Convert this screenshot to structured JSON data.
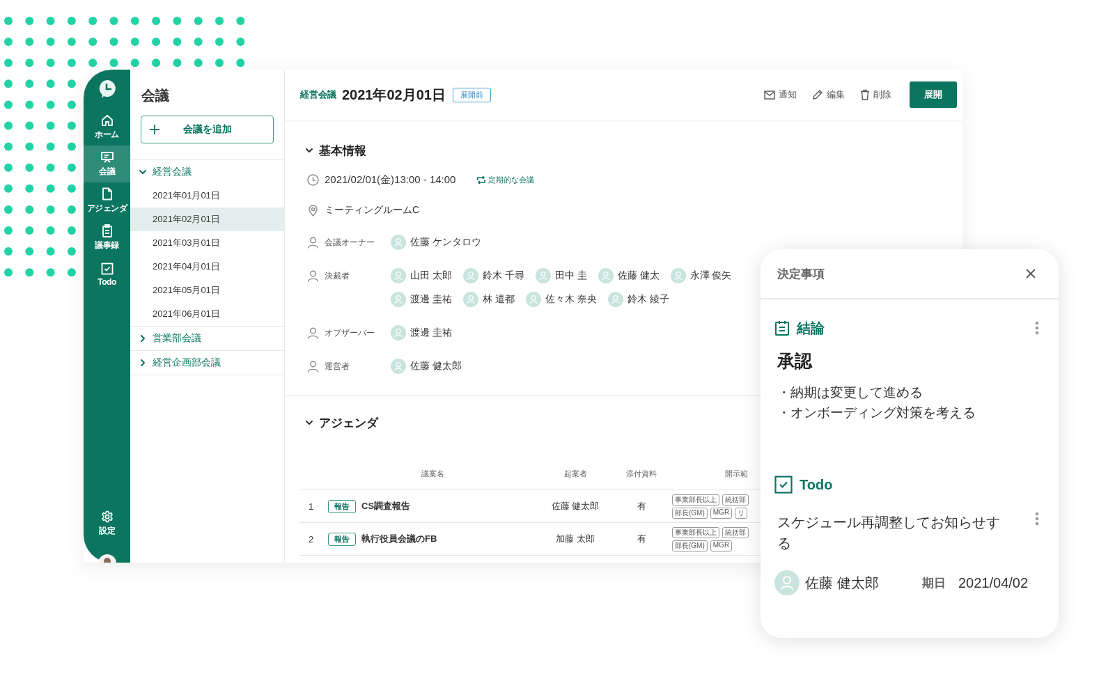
{
  "nav_rail": {
    "items": [
      {
        "label": "ホーム",
        "selected": false
      },
      {
        "label": "会議",
        "selected": true
      },
      {
        "label": "アジェンダ",
        "selected": false
      },
      {
        "label": "議事録",
        "selected": false
      },
      {
        "label": "Todo",
        "selected": false
      }
    ],
    "settings": "設定"
  },
  "sidebar": {
    "title": "会議",
    "add_button": "会議を追加",
    "groups": [
      {
        "label": "経営会議",
        "expanded": true,
        "children": [
          {
            "label": "2021年01月01日",
            "selected": false
          },
          {
            "label": "2021年02月01日",
            "selected": true
          },
          {
            "label": "2021年03月01日",
            "selected": false
          },
          {
            "label": "2021年04月01日",
            "selected": false
          },
          {
            "label": "2021年05月01日",
            "selected": false
          },
          {
            "label": "2021年06月01日",
            "selected": false
          }
        ]
      },
      {
        "label": "営業部会議",
        "expanded": false
      },
      {
        "label": "経営企画部会議",
        "expanded": false
      }
    ]
  },
  "header": {
    "breadcrumb": "経営会議",
    "title": "2021年02月01日",
    "status": "展開前",
    "actions": [
      "通知",
      "編集",
      "削除"
    ],
    "primary_button": "展開"
  },
  "basic_info": {
    "heading": "基本情報",
    "expanded": true,
    "datetime": "2021/02/01(金)13:00 - 14:00",
    "recurring": "定期的な会議",
    "location": "ミーティングルームC",
    "roles": [
      {
        "label": "会議オーナー",
        "people": [
          "佐藤 ケンタロウ"
        ]
      },
      {
        "label": "決裁者",
        "people": [
          "山田 太郎",
          "鈴木 千尋",
          "田中 圭",
          "佐藤 健太",
          "永澤 俊矢",
          "渡邊 圭祐",
          "林 遣都",
          "佐々木 奈央",
          "鈴木 綾子"
        ]
      },
      {
        "label": "オブザーバー",
        "people": [
          "渡邊 圭祐"
        ]
      },
      {
        "label": "運営者",
        "people": [
          "佐藤 健太郎"
        ]
      }
    ]
  },
  "agenda": {
    "heading": "アジェンダ",
    "expanded": true,
    "columns": [
      "議案名",
      "起案者",
      "添付資料",
      "開示範"
    ],
    "rows": [
      {
        "number": "1",
        "tag": "報告",
        "title": "CS調査報告",
        "proposer": "佐藤 健太郎",
        "attachment": "有",
        "scope": [
          "事業部長以上",
          "統括部",
          "部長(GM)",
          "MGR",
          "リ"
        ]
      },
      {
        "number": "2",
        "tag": "報告",
        "title": "執行役員会議のFB",
        "proposer": "加藤 太郎",
        "attachment": "有",
        "scope": [
          "事業部長以上",
          "統括部",
          "部長(GM)",
          "MGR"
        ]
      }
    ]
  },
  "decision_panel": {
    "title": "決定事項",
    "conclusion": {
      "heading": "結論",
      "title": "承認",
      "points": [
        "・納期は変更して進める",
        "・オンボーディング対策を考える"
      ]
    },
    "todo": {
      "heading": "Todo",
      "text": "スケジュール再調整してお知らせする",
      "assignee": "佐藤 健太郎",
      "due_label": "期日",
      "due_date": "2021/04/02"
    }
  }
}
